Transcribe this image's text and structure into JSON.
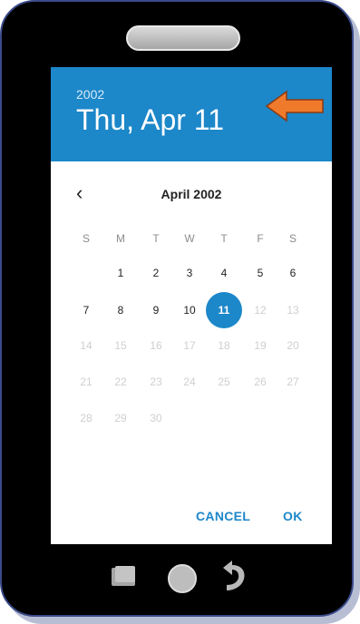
{
  "dialog": {
    "year": "2002",
    "selected_date": "Thu, Apr 11",
    "month_label": "April 2002",
    "prev_month_icon": "chevron-left-icon",
    "weekdays": [
      "S",
      "M",
      "T",
      "W",
      "T",
      "F",
      "S"
    ],
    "days": [
      [
        "",
        "1",
        "2",
        "3",
        "4",
        "5",
        "6"
      ],
      [
        "7",
        "8",
        "9",
        "10",
        "11",
        "12",
        "13"
      ],
      [
        "14",
        "15",
        "16",
        "17",
        "18",
        "19",
        "20"
      ],
      [
        "21",
        "22",
        "23",
        "24",
        "25",
        "26",
        "27"
      ],
      [
        "28",
        "29",
        "30",
        "",
        "",
        "",
        ""
      ]
    ],
    "selected_day": "11",
    "cancel_label": "CANCEL",
    "ok_label": "OK",
    "accent_color": "#1c87c9",
    "disabled_color": "#cfcfcf"
  },
  "annotation": {
    "arrow_icon": "arrow-left-icon",
    "arrow_color": "#f07a2c"
  },
  "device": {
    "frame_color": "#000000",
    "buttons": [
      "recent-apps-icon",
      "home-icon",
      "back-icon"
    ]
  }
}
